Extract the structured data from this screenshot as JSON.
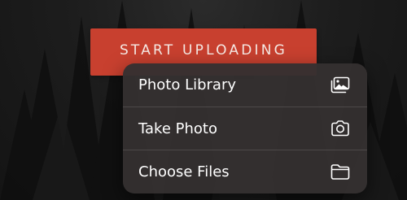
{
  "upload_button": {
    "label": "START UPLOADING"
  },
  "menu": {
    "items": [
      {
        "label": "Photo Library",
        "icon": "photo-library-icon"
      },
      {
        "label": "Take Photo",
        "icon": "camera-icon"
      },
      {
        "label": "Choose Files",
        "icon": "folder-icon"
      }
    ]
  },
  "colors": {
    "button_bg": "#c8402f",
    "button_text": "#f5e9e4",
    "menu_bg": "#343030",
    "menu_text": "#ffffff"
  }
}
